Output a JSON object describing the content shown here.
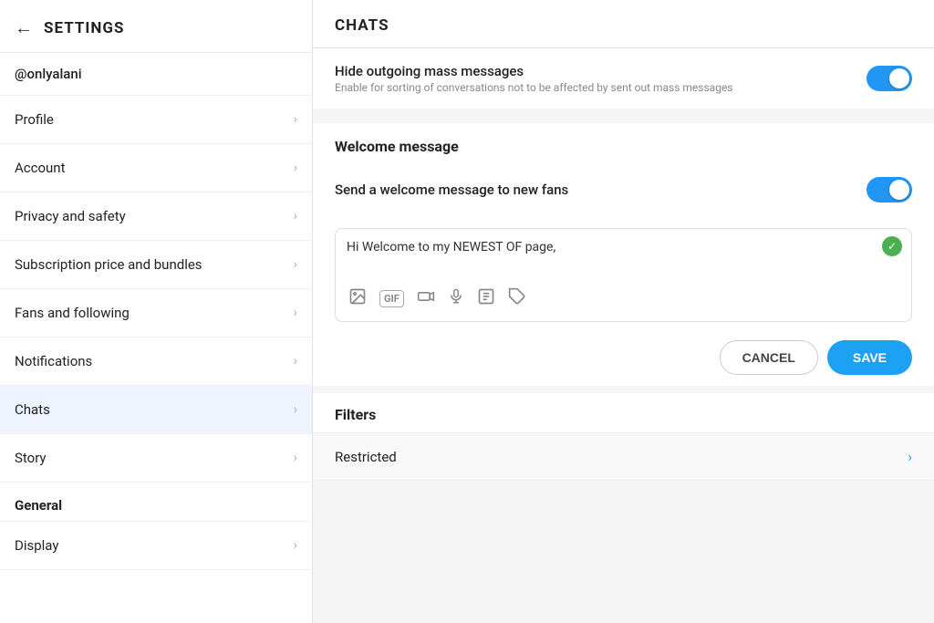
{
  "sidebar": {
    "title": "SETTINGS",
    "back_label": "←",
    "username": "@onlyalani",
    "items": [
      {
        "id": "profile",
        "label": "Profile",
        "active": false
      },
      {
        "id": "account",
        "label": "Account",
        "active": false
      },
      {
        "id": "privacy",
        "label": "Privacy and safety",
        "active": false
      },
      {
        "id": "subscription",
        "label": "Subscription price and bundles",
        "active": false
      },
      {
        "id": "fans",
        "label": "Fans and following",
        "active": false
      },
      {
        "id": "notifications",
        "label": "Notifications",
        "active": false
      },
      {
        "id": "chats",
        "label": "Chats",
        "active": true
      },
      {
        "id": "story",
        "label": "Story",
        "active": false
      }
    ],
    "section_label": "General",
    "general_items": [
      {
        "id": "display",
        "label": "Display",
        "active": false
      }
    ]
  },
  "main": {
    "title": "CHATS",
    "hide_outgoing": {
      "label": "Hide outgoing mass messages",
      "description": "Enable for sorting of conversations not to be affected by sent out mass messages",
      "enabled": true
    },
    "welcome_message": {
      "section_label": "Welcome message",
      "send_label": "Send a welcome message to new fans",
      "enabled": true,
      "message_text": "Hi Welcome to my NEWEST OF page,",
      "toolbar_icons": [
        "image-icon",
        "gif-icon",
        "video-icon",
        "mic-icon",
        "poll-icon",
        "tag-icon"
      ]
    },
    "actions": {
      "cancel_label": "CANCEL",
      "save_label": "SAVE"
    },
    "filters": {
      "title": "Filters",
      "restricted_label": "Restricted"
    }
  },
  "icons": {
    "back": "←",
    "chevron": "›",
    "check": "✓",
    "image": "🖼",
    "gif": "GIF",
    "video": "▶",
    "mic": "🎤",
    "poll": "⊞",
    "tag": "🏷"
  }
}
